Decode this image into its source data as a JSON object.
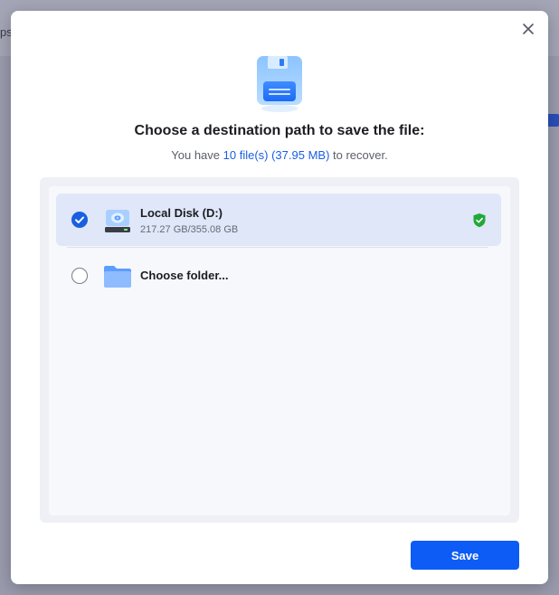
{
  "background": {
    "partial_text": "ps"
  },
  "dialog": {
    "title": "Choose a destination path to save the file:",
    "subtitle_prefix": "You have ",
    "subtitle_highlight": "10 file(s) (37.95 MB)",
    "subtitle_suffix": " to recover.",
    "save_label": "Save",
    "destinations": [
      {
        "name": "Local Disk (D:)",
        "size": "217.27 GB/355.08 GB",
        "selected": true,
        "icon": "hard-drive-icon",
        "protected_icon": "shield-check-icon"
      },
      {
        "name": "Choose folder...",
        "selected": false,
        "icon": "folder-icon"
      }
    ]
  },
  "colors": {
    "accent": "#1a5fe0",
    "button": "#0d5cf5",
    "shield": "#22a83a",
    "selected_row": "#dfe7f8"
  }
}
